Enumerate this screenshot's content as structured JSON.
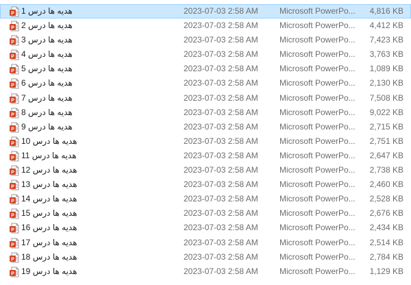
{
  "file_type_icon": "powerpoint-file-icon",
  "selection_color": "#cce8ff",
  "rows": [
    {
      "name": "هدیه ها درس 1",
      "date": "2023-07-03 2:58 AM",
      "type": "Microsoft PowerPo...",
      "size": "4,816 KB",
      "selected": true
    },
    {
      "name": "هدیه ها درس 2",
      "date": "2023-07-03 2:58 AM",
      "type": "Microsoft PowerPo...",
      "size": "4,412 KB"
    },
    {
      "name": "هدیه ها درس 3",
      "date": "2023-07-03 2:58 AM",
      "type": "Microsoft PowerPo...",
      "size": "7,423 KB"
    },
    {
      "name": "هدیه ها درس 4",
      "date": "2023-07-03 2:58 AM",
      "type": "Microsoft PowerPo...",
      "size": "3,763 KB"
    },
    {
      "name": "هدیه ها درس 5",
      "date": "2023-07-03 2:58 AM",
      "type": "Microsoft PowerPo...",
      "size": "1,089 KB"
    },
    {
      "name": "هدیه ها درس 6",
      "date": "2023-07-03 2:58 AM",
      "type": "Microsoft PowerPo...",
      "size": "2,130 KB"
    },
    {
      "name": "هدیه ها درس 7",
      "date": "2023-07-03 2:58 AM",
      "type": "Microsoft PowerPo...",
      "size": "7,508 KB"
    },
    {
      "name": "هدیه ها درس 8",
      "date": "2023-07-03 2:58 AM",
      "type": "Microsoft PowerPo...",
      "size": "9,022 KB"
    },
    {
      "name": "هدیه ها درس 9",
      "date": "2023-07-03 2:58 AM",
      "type": "Microsoft PowerPo...",
      "size": "2,715 KB"
    },
    {
      "name": "هدیه ها درس 10",
      "date": "2023-07-03 2:58 AM",
      "type": "Microsoft PowerPo...",
      "size": "2,751 KB"
    },
    {
      "name": "هدیه ها درس 11",
      "date": "2023-07-03 2:58 AM",
      "type": "Microsoft PowerPo...",
      "size": "2,647 KB"
    },
    {
      "name": "هدیه ها درس 12",
      "date": "2023-07-03 2:58 AM",
      "type": "Microsoft PowerPo...",
      "size": "2,738 KB"
    },
    {
      "name": "هدیه ها درس 13",
      "date": "2023-07-03 2:58 AM",
      "type": "Microsoft PowerPo...",
      "size": "2,460 KB"
    },
    {
      "name": "هدیه ها درس 14",
      "date": "2023-07-03 2:58 AM",
      "type": "Microsoft PowerPo...",
      "size": "2,528 KB"
    },
    {
      "name": "هدیه ها درس 15",
      "date": "2023-07-03 2:58 AM",
      "type": "Microsoft PowerPo...",
      "size": "2,676 KB"
    },
    {
      "name": "هدیه ها درس 16",
      "date": "2023-07-03 2:58 AM",
      "type": "Microsoft PowerPo...",
      "size": "2,434 KB"
    },
    {
      "name": "هدیه ها درس 17",
      "date": "2023-07-03 2:58 AM",
      "type": "Microsoft PowerPo...",
      "size": "2,514 KB"
    },
    {
      "name": "هدیه ها درس 18",
      "date": "2023-07-03 2:58 AM",
      "type": "Microsoft PowerPo...",
      "size": "2,784 KB"
    },
    {
      "name": "هدیه ها درس 19",
      "date": "2023-07-03 2:58 AM",
      "type": "Microsoft PowerPo...",
      "size": "1,129 KB"
    }
  ]
}
